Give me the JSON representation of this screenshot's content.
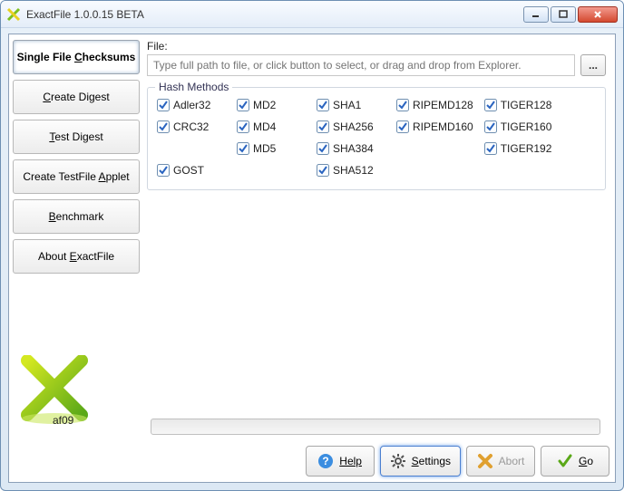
{
  "window": {
    "title": "ExactFile 1.0.0.15 BETA"
  },
  "sidebar": {
    "tabs": [
      {
        "label_pre": "Single File ",
        "key": "C",
        "label_post": "hecksums"
      },
      {
        "label_pre": "",
        "key": "C",
        "label_post": "reate Digest"
      },
      {
        "label_pre": "",
        "key": "T",
        "label_post": "est Digest"
      },
      {
        "label_pre": "Create TestFile ",
        "key": "A",
        "label_post": "pplet"
      },
      {
        "label_pre": "",
        "key": "B",
        "label_post": "enchmark"
      },
      {
        "label_pre": "About ",
        "key": "E",
        "label_post": "xactFile"
      }
    ]
  },
  "brand_text": "af09",
  "content": {
    "file_label": "File:",
    "file_placeholder": "Type full path to file, or click button to select, or drag and drop from Explorer.",
    "browse_label": "...",
    "group_title": "Hash Methods",
    "columns": [
      [
        "Adler32",
        "CRC32",
        "",
        "GOST"
      ],
      [
        "MD2",
        "MD4",
        "MD5"
      ],
      [
        "SHA1",
        "SHA256",
        "SHA384",
        "SHA512"
      ],
      [
        "RIPEMD128",
        "RIPEMD160"
      ],
      [
        "TIGER128",
        "TIGER160",
        "TIGER192"
      ]
    ]
  },
  "buttons": {
    "help": "Help",
    "settings": "Settings",
    "abort": "Abort",
    "go": "Go"
  }
}
